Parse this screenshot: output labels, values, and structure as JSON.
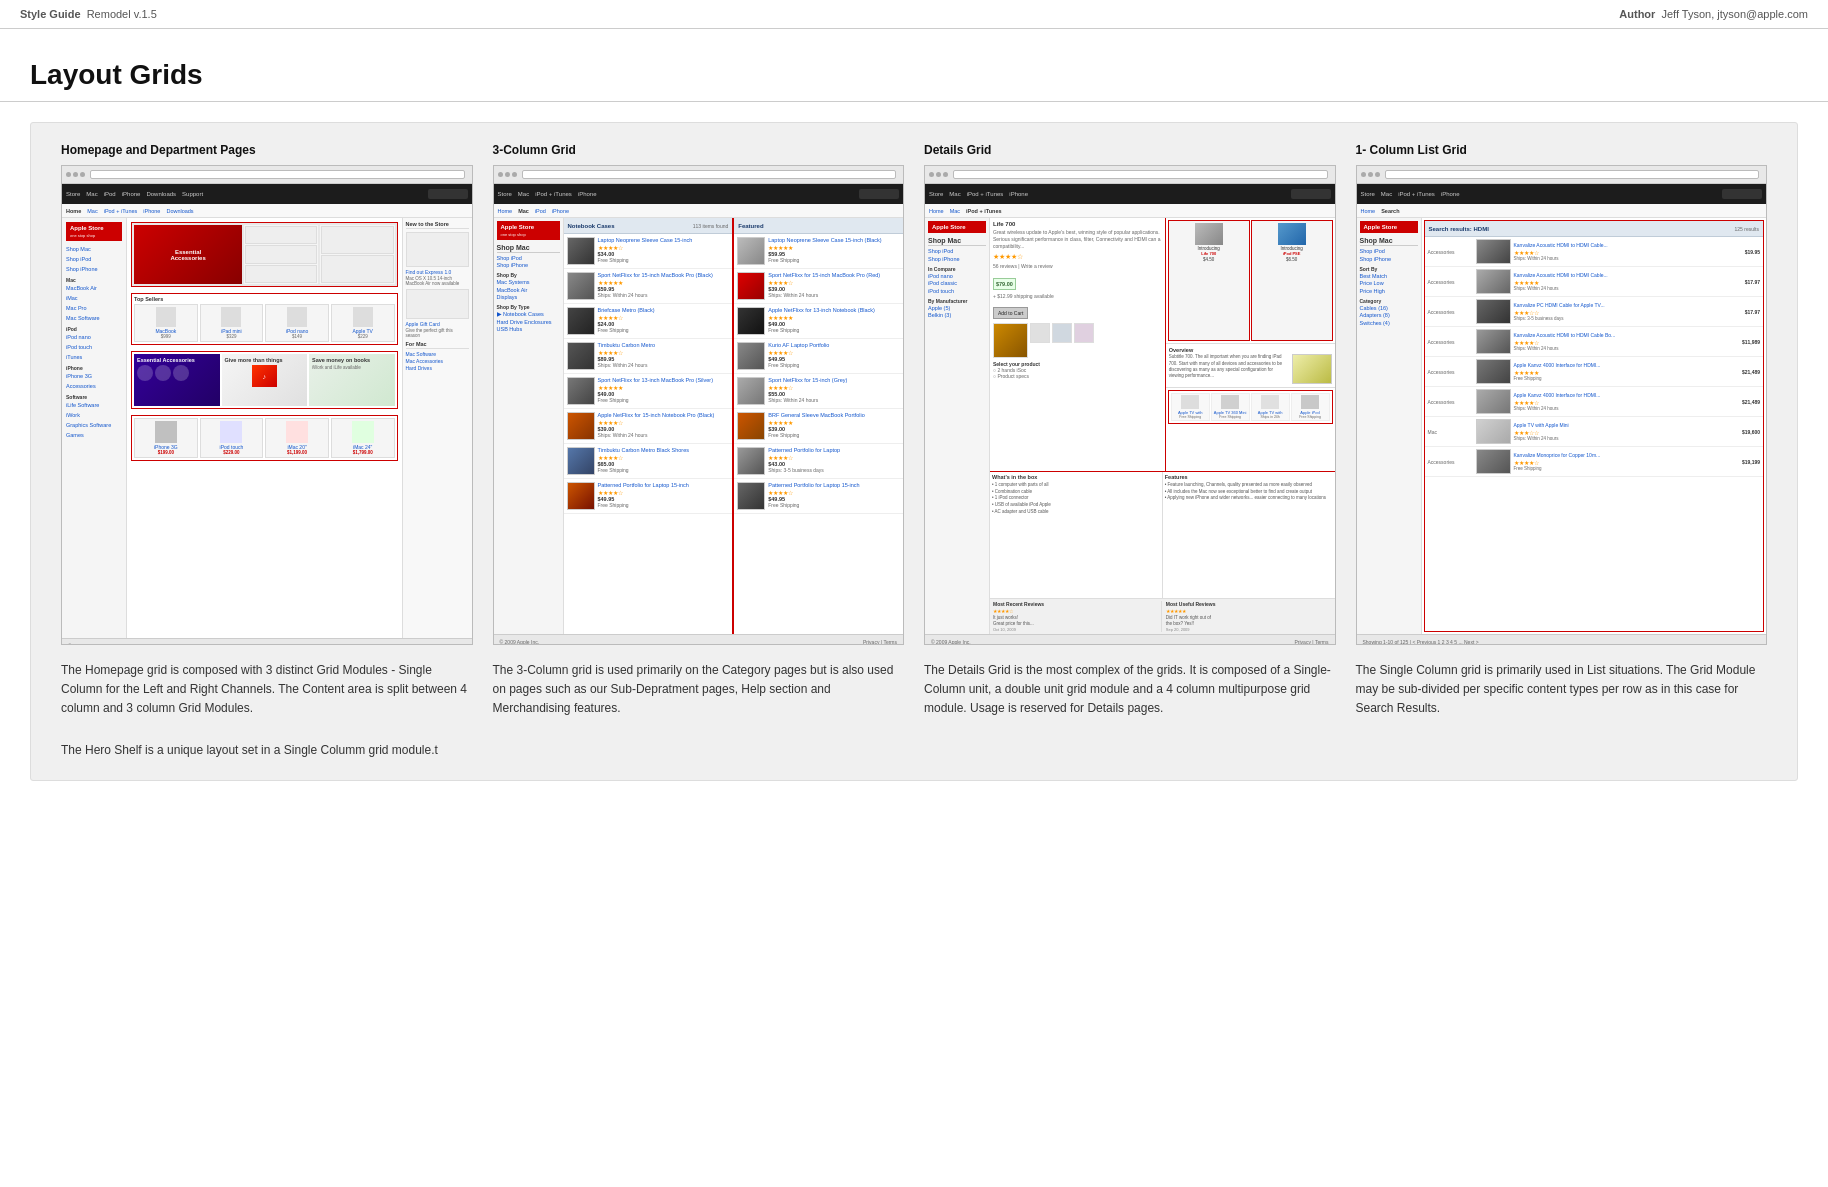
{
  "header": {
    "style_guide_label": "Style Guide",
    "style_guide_version": "Remodel v.1.5",
    "author_label": "Author",
    "author_name": "Jeff Tyson, jtyson@apple.com"
  },
  "page_title": "Layout Grids",
  "sections": [
    {
      "id": "homepage",
      "title": "Homepage and Department Pages",
      "description_1": "The Homepage grid is composed with 3 distinct Grid Modules - Single Column for the Left and Right Channels. The Content area is split between 4 column and 3 column Grid Modules.",
      "description_2": "The Hero Shelf is a unique layout set in a Single Columm grid module.t"
    },
    {
      "id": "three-col",
      "title": "3-Column Grid",
      "description_1": "The 3-Column grid is used primarily on the Category pages but is also used on pages such as our Sub-Depratment pages, Help section and Merchandising features."
    },
    {
      "id": "details",
      "title": "Details Grid",
      "description_1": "The Details Grid is the most complex of the grids. It is composed of a Single-Column unit, a double unit grid module and a 4 column multipurpose grid module. Usage is reserved for Details pages."
    },
    {
      "id": "single-col",
      "title": "1- Column List Grid",
      "description_1": "The Single Column grid is primarily used in List situations. The Grid Module may be sub-divided per specific content types per row as in this case for Search Results."
    }
  ],
  "mock": {
    "apple_store": "Apple Store",
    "nav_items": [
      "Store",
      "Mac",
      "iPod + iTunes",
      "iPhone",
      "Downloads",
      "Support"
    ],
    "sidebar_links": [
      "Shop Mac",
      "Shop iPod",
      "Shop iPhone"
    ],
    "notebook_cases": "Notebook Cases",
    "search_results_hdmi": "Search results: HDMI",
    "product_names": [
      "Laptop Neoprene Sleeve Case...",
      "Sport NetFlixx for 15\"...",
      "Briefcase Metro (Black)...",
      "Timbuktu Carbon...",
      "Sport NetFlixx for 13\"...",
      "BRF General...",
      "Sport NetFlixx for 15\"...",
      "Kurio AF Laptop Portfolio..."
    ],
    "prices": [
      "$34.00",
      "$59.95",
      "$24.00",
      "$89.95",
      "$49.00",
      "$39.00",
      "$65.00",
      "$49.95"
    ],
    "result_count": "113 items found"
  }
}
